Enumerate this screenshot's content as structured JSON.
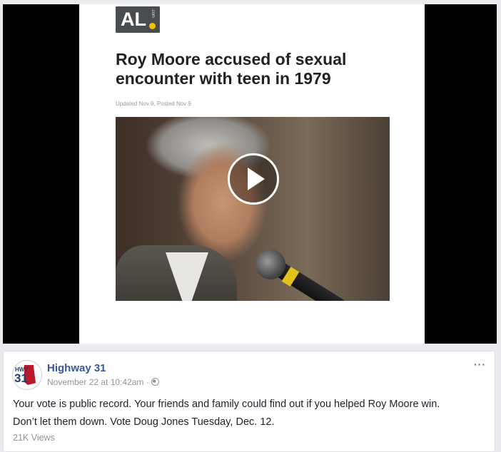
{
  "video": {
    "article": {
      "logo_text": "AL",
      "logo_com": ".com",
      "headline": "Roy Moore accused of sexual encounter with teen in 1979",
      "timestamp": "Updated Nov 9, Posted Nov 9"
    },
    "play_icon": "play-icon"
  },
  "post": {
    "avatar": {
      "hwy": "HWY",
      "num": "31"
    },
    "page_name": "Highway 31",
    "date": "November 22 at 10:42am",
    "separator": "·",
    "privacy_icon": "globe-icon",
    "more_label": "···",
    "text_line_1": "Your vote is public record. Your friends and family could find out if you helped Roy Moore win.",
    "text_line_2": "Don’t let them down. Vote Doug Jones Tuesday, Dec. 12.",
    "views": "21K Views"
  },
  "colors": {
    "link": "#365899",
    "meta": "#90949c",
    "logo_bg": "#4a4d50",
    "logo_dot": "#f5c400"
  }
}
